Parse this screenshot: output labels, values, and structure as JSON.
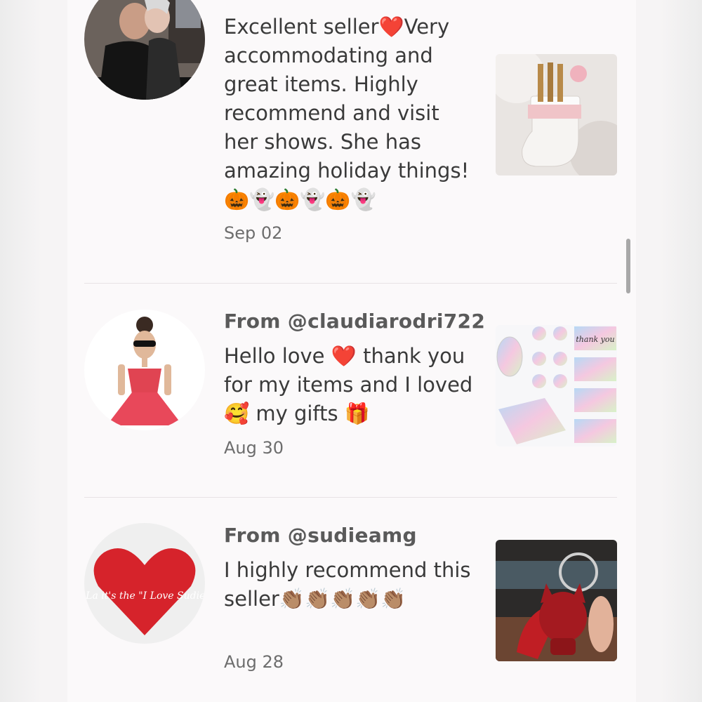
{
  "reviews": [
    {
      "text": "Excellent seller❤️Very accommodating and great items. Highly recommend and visit her shows. She has amazing holiday things! 🎃👻🎃👻🎃👻",
      "date": "Sep 02"
    },
    {
      "author": "From @claudiarodri722",
      "text": "Hello love ❤️ thank you for my items and I loved 🥰 my gifts 🎁",
      "date": "Aug 30"
    },
    {
      "author": "From @sudieamg",
      "text": "I highly recommend this seller👏🏽👏🏽👏🏽👏🏽👏🏽",
      "date": "Aug 28"
    }
  ],
  "images": {
    "avatar3_text": "ooh La La it's the \"I Love Sudie\" Show",
    "thumb2_text": "thank you"
  },
  "colors": {
    "accent_red": "#d6232b",
    "text": "#3a3a3a",
    "meta": "#6d6d6d"
  }
}
